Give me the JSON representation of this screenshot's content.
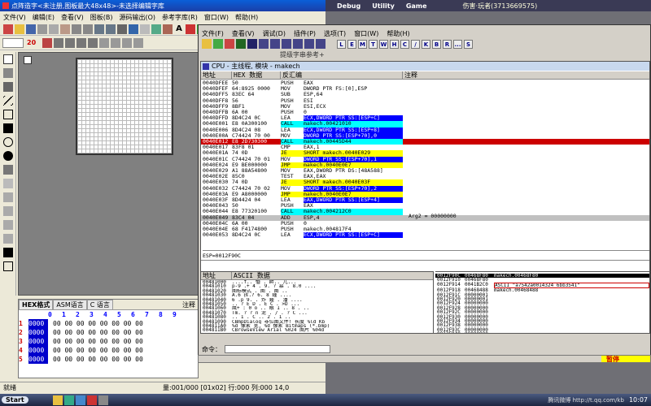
{
  "left_app": {
    "title": "点阵造字<未注册,图板最大48x48>-未选择编辑字库",
    "menu": [
      "文件(V)",
      "编辑(E)",
      "查看(V)",
      "图板(B)",
      "源码输出(O)",
      "参考字库(R)",
      "窗口(W)",
      "帮助(H)"
    ],
    "font_size": "20",
    "text_tool": "A",
    "preview_tabs": [
      "HEX格式",
      "ASM语言",
      "C 语言"
    ],
    "note_label": "注释",
    "hex_header": [
      "0",
      "1",
      "2",
      "3",
      "4",
      "5",
      "6",
      "7",
      "8",
      "9"
    ],
    "hex_rows": [
      {
        "n": "1",
        "v": "0000"
      },
      {
        "n": "2",
        "v": "0000"
      },
      {
        "n": "3",
        "v": "0000"
      },
      {
        "n": "4",
        "v": "0000"
      },
      {
        "n": "5",
        "v": "0000"
      }
    ],
    "hex_filler": "00 00 00 00 00 00 00 00",
    "status_ready": "就绪",
    "status_info": "量:001/000 [01x02] 行:000 列:000 14,0"
  },
  "top_right_tabs": [
    "Debug",
    "Utility",
    "Game"
  ],
  "top_right_user": "伤害·玩者(3713669575)",
  "od": {
    "menu": [
      "文件(F)",
      "查看(V)",
      "调试(D)",
      "插件(P)",
      "选项(T)",
      "窗口(W)",
      "帮助(H)"
    ],
    "letter_buttons": [
      "L",
      "E",
      "M",
      "T",
      "W",
      "H",
      "C",
      "/",
      "K",
      "B",
      "R",
      "...",
      "S"
    ],
    "side_tab": "提级字串参考+",
    "cpu_title": "CPU - 主线程, 模块 - makech",
    "disasm_headers": [
      "地址",
      "HEX 数据",
      "反汇编",
      "注释"
    ],
    "disasm_rows": [
      [
        "0040DFEE",
        "50",
        "PUSH",
        "EAX"
      ],
      [
        "0040DFEF",
        "64:8925 0000",
        "MOV",
        "DWORD PTR FS:[0],ESP"
      ],
      [
        "0040DFF5",
        "83EC 64",
        "SUB",
        "ESP,64"
      ],
      [
        "0040DFF8",
        "56",
        "PUSH",
        "ESI"
      ],
      [
        "0040DFF9",
        "8BF1",
        "MOV",
        "ESI,ECX"
      ],
      [
        "0040DFFB",
        "6A 00",
        "PUSH",
        "0"
      ],
      [
        "0040DFFD",
        "8D4C24 0C",
        "LEA",
        "ECX,DWORD PTR SS:[ESP+C]"
      ],
      [
        "0040E001",
        "E8 0A300100",
        "CALL",
        "makech.00421010"
      ],
      [
        "0040E006",
        "8D4C24 08",
        "LEA",
        "ECX,DWORD PTR SS:[ESP+8]"
      ],
      [
        "0040E00A",
        "C74424 70 00",
        "MOV",
        "DWORD PTR SS:[ESP+70],0"
      ],
      [
        "0040E012",
        "E8 2D730300",
        "CALL",
        "makech.00445D44"
      ],
      [
        "0040E017",
        "83F8 01",
        "CMP",
        "EAX,1"
      ],
      [
        "0040E01A",
        "74 0D",
        "JE",
        "SHORT makech.0040E029"
      ],
      [
        "0040E01C",
        "C74424 70 01",
        "MOV",
        "DWORD PTR SS:[ESP+70],1"
      ],
      [
        "0040E024",
        "E9 BE000000",
        "JMP",
        "makech.0040E0E7"
      ],
      [
        "0040E029",
        "A1 88A54800",
        "MOV",
        "EAX,DWORD PTR DS:[48A588]"
      ],
      [
        "0040E02E",
        "85C0",
        "TEST",
        "EAX,EAX"
      ],
      [
        "0040E030",
        "74 0D",
        "JE",
        "SHORT makech.0040E03F"
      ],
      [
        "0040E032",
        "C74424 70 02",
        "MOV",
        "DWORD PTR SS:[ESP+70],2"
      ],
      [
        "0040E03A",
        "E9 A8000000",
        "JMP",
        "makech.0040E0E7"
      ],
      [
        "0040E03F",
        "8D4424 04",
        "LEA",
        "EAX,DWORD PTR SS:[ESP+4]"
      ],
      [
        "0040E043",
        "50",
        "PUSH",
        "EAX"
      ],
      [
        "0040E044",
        "E8 77320100",
        "CALL",
        "makech.004212C0"
      ],
      [
        "0040E049",
        "83C4 04",
        "ADD",
        "ESP,4"
      ],
      [
        "0040E04C",
        "6A 00",
        "PUSH",
        "0"
      ],
      [
        "0040E04E",
        "68 F4174800",
        "PUSH",
        "makech.004817F4"
      ],
      [
        "0040E053",
        "8D4C24 0C",
        "LEA",
        "ECX,DWORD PTR SS:[ESP+C]"
      ]
    ],
    "register_note": "Arg2 = 00000000",
    "info_line": "ESP=0012F90C",
    "dump_headers": [
      "地址",
      "ASCII 数据"
    ],
    "dump_rows": [
      [
        "00481000",
        "....f..  惛 . 衅.. 兀..."
      ],
      [
        "00481010",
        "p-9 .+ 4 . 9. ?   慕 . 8.0 ...."
      ],
      [
        "00481020",
        "图标模式 . 图 . 图  .."
      ],
      [
        "00481030",
        "A.6 拆.?  6. 8 鍾 ...."
      ],
      [
        "00481040",
        "6 .p 9.  . 炸 鍾 . 潘 ...."
      ],
      [
        "00481050",
        "..  ?  E D . E C  .  >D  ..."
      ],
      [
        "00481060",
        "鹰+ : 0 o .. 眼 I .. 8 . .."
      ],
      [
        "00481070",
        "Tm. ? ?  n 泥 . / . ?  C  ..."
      ],
      [
        "00481080",
        ".. 1 . C  ..  2  . 1 .."
      ],
      [
        "00481090",
        "CBmpDialog  非位图文件! 长度  %ld Kb"
      ],
      [
        "004811A0",
        "%d 像素 宽, %d 像素 Bitmaps (*.bmp)"
      ],
      [
        "004811B0",
        "CBrowseView Arial  %024  图片 %04d"
      ]
    ],
    "stack_rows": [
      [
        "0012F90C",
        "00468F80",
        "makech.00468F80"
      ],
      [
        "0012F910",
        "00468F80",
        ""
      ],
      [
        "0012F914",
        "0041B2C0",
        "ASCII \"a7542a0014324 6bb3541\""
      ],
      [
        "0012F918",
        "00468488",
        "makech.00468488"
      ],
      [
        "0012F91C",
        "00000001",
        ""
      ],
      [
        "0012F920",
        "00000001",
        ""
      ],
      [
        "0012F924",
        "00000000",
        ""
      ],
      [
        "0012F928",
        "00000000",
        ""
      ],
      [
        "0012F92C",
        "00000000",
        ""
      ],
      [
        "0012F930",
        "00000000",
        ""
      ],
      [
        "0012F934",
        "00000000",
        ""
      ],
      [
        "0012F938",
        "00000000",
        ""
      ],
      [
        "0012F93C",
        "00000000",
        ""
      ],
      [
        "0012F940",
        "00000000",
        ""
      ]
    ],
    "cmd_label": "命令：",
    "status_paused": "暂停"
  },
  "taskbar": {
    "start": "Start",
    "clock": "10:07",
    "watermark": "腾讯微博 http://t.qq.com/kb"
  }
}
